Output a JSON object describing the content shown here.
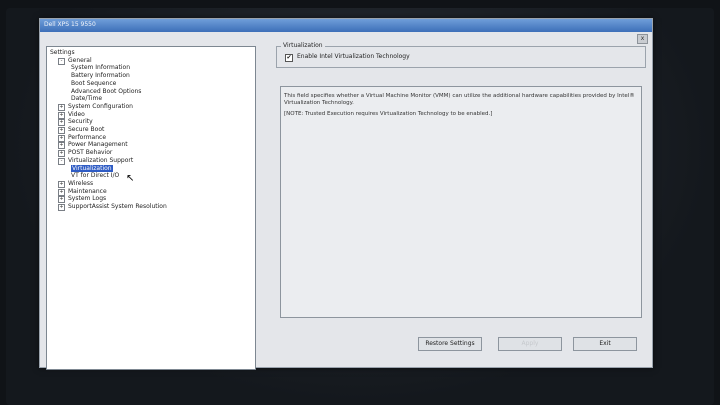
{
  "window": {
    "title": "Dell XPS 15 9550",
    "close_label": "x"
  },
  "tree": {
    "items": [
      {
        "label": "Settings",
        "level": 0,
        "expander": ""
      },
      {
        "label": "General",
        "level": 1,
        "expander": "-"
      },
      {
        "label": "System Information",
        "level": 2,
        "expander": ""
      },
      {
        "label": "Battery Information",
        "level": 2,
        "expander": ""
      },
      {
        "label": "Boot Sequence",
        "level": 2,
        "expander": ""
      },
      {
        "label": "Advanced Boot Options",
        "level": 2,
        "expander": ""
      },
      {
        "label": "Date/Time",
        "level": 2,
        "expander": ""
      },
      {
        "label": "System Configuration",
        "level": 1,
        "expander": "+"
      },
      {
        "label": "Video",
        "level": 1,
        "expander": "+"
      },
      {
        "label": "Security",
        "level": 1,
        "expander": "+"
      },
      {
        "label": "Secure Boot",
        "level": 1,
        "expander": "+"
      },
      {
        "label": "Performance",
        "level": 1,
        "expander": "+"
      },
      {
        "label": "Power Management",
        "level": 1,
        "expander": "+"
      },
      {
        "label": "POST Behavior",
        "level": 1,
        "expander": "+"
      },
      {
        "label": "Virtualization Support",
        "level": 1,
        "expander": "-"
      },
      {
        "label": "Virtualization",
        "level": 2,
        "expander": "",
        "selected": true
      },
      {
        "label": "VT for Direct I/O",
        "level": 2,
        "expander": ""
      },
      {
        "label": "Wireless",
        "level": 1,
        "expander": "+"
      },
      {
        "label": "Maintenance",
        "level": 1,
        "expander": "+"
      },
      {
        "label": "System Logs",
        "level": 1,
        "expander": "+"
      },
      {
        "label": "SupportAssist System Resolution",
        "level": 1,
        "expander": "+"
      }
    ]
  },
  "panel": {
    "group_title": "Virtualization",
    "checkbox_label": "Enable Intel Virtualization Technology",
    "checkbox_checked": true,
    "description": "This field specifies whether a Virtual Machine Monitor (VMM) can utilize the additional hardware capabilities provided by Intel® Virtualization Technology.",
    "note": "[NOTE: Trusted Execution requires Virtualization Technology to be enabled.]"
  },
  "buttons": {
    "restore": "Restore Settings",
    "apply": "Apply",
    "exit": "Exit"
  }
}
